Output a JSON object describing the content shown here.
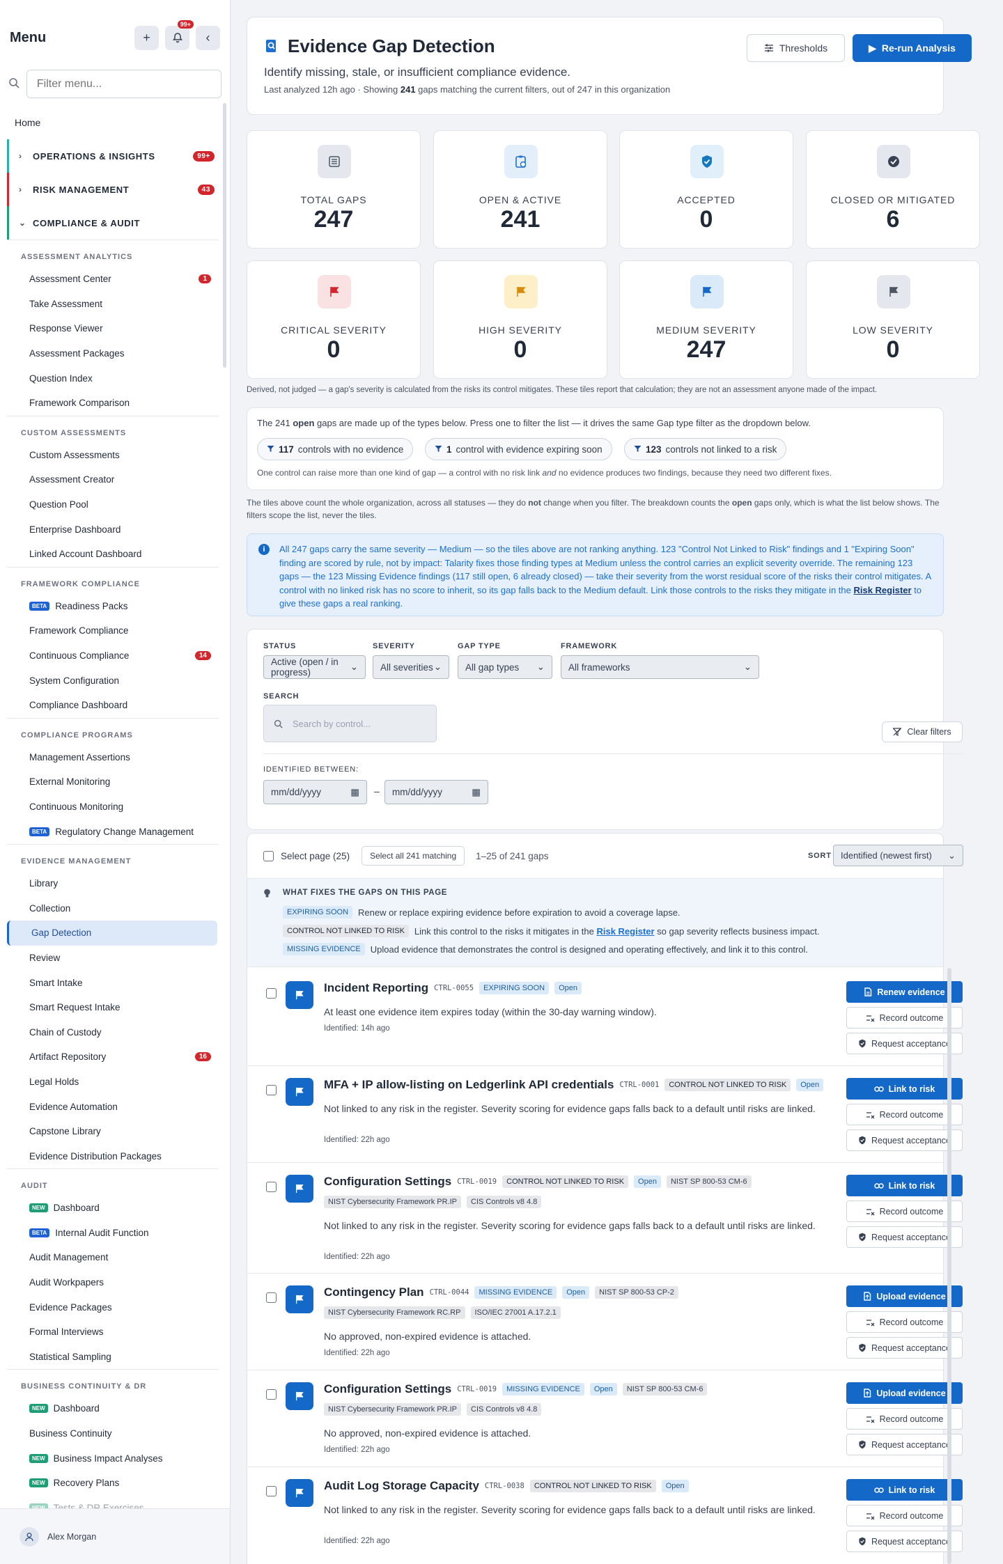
{
  "sidebar": {
    "title": "Menu",
    "notif_badge": "99+",
    "filter_placeholder": "Filter menu...",
    "home": "Home",
    "groups": {
      "ops": {
        "label": "OPERATIONS & INSIGHTS",
        "count": "99+"
      },
      "risk": {
        "label": "RISK MANAGEMENT",
        "count": "43"
      },
      "comp": {
        "label": "COMPLIANCE & AUDIT"
      }
    },
    "sections": {
      "assess": {
        "label": "ASSESSMENT ANALYTICS",
        "items": [
          "Assessment Center",
          "Take Assessment",
          "Response Viewer",
          "Assessment Packages",
          "Question Index",
          "Framework Comparison"
        ],
        "assess_center_count": "1"
      },
      "custom": {
        "label": "CUSTOM ASSESSMENTS",
        "items": [
          "Custom Assessments",
          "Assessment Creator",
          "Question Pool",
          "Enterprise Dashboard",
          "Linked Account Dashboard"
        ]
      },
      "framework": {
        "label": "FRAMEWORK COMPLIANCE",
        "items": [
          "Readiness Packs",
          "Framework Compliance",
          "Continuous Compliance",
          "System Configuration",
          "Compliance Dashboard"
        ],
        "cc_count": "14"
      },
      "programs": {
        "label": "COMPLIANCE PROGRAMS",
        "items": [
          "Management Assertions",
          "External Monitoring",
          "Continuous Monitoring",
          "Regulatory Change Management"
        ]
      },
      "evidence": {
        "label": "EVIDENCE MANAGEMENT",
        "items": [
          "Library",
          "Collection",
          "Gap Detection",
          "Review",
          "Smart Intake",
          "Smart Request Intake",
          "Chain of Custody",
          "Artifact Repository",
          "Legal Holds",
          "Evidence Automation",
          "Capstone Library",
          "Evidence Distribution Packages"
        ],
        "artifact_count": "16"
      },
      "audit": {
        "label": "AUDIT",
        "items": [
          "Dashboard",
          "Internal Audit Function",
          "Audit Management",
          "Audit Workpapers",
          "Evidence Packages",
          "Formal Interviews",
          "Statistical Sampling"
        ]
      },
      "bcdr": {
        "label": "BUSINESS CONTINUITY & DR",
        "items": [
          "Dashboard",
          "Business Continuity",
          "Business Impact Analyses",
          "Recovery Plans",
          "Tests & DR Exercises"
        ]
      }
    },
    "tags": {
      "beta": "BETA",
      "new": "NEW"
    },
    "user": "Alex Morgan"
  },
  "header": {
    "title": "Evidence Gap Detection",
    "subtitle": "Identify missing, stale, or insufficient compliance evidence.",
    "meta_prefix": "Last analyzed 12h ago · Showing ",
    "meta_count": "241",
    "meta_suffix": " gaps matching the current filters, out of 247 in this organization",
    "thresholds": "Thresholds",
    "rerun": "Re-run Analysis"
  },
  "tiles": [
    {
      "label": "TOTAL GAPS",
      "value": "247"
    },
    {
      "label": "OPEN & ACTIVE",
      "value": "241"
    },
    {
      "label": "ACCEPTED",
      "value": "0"
    },
    {
      "label": "CLOSED OR MITIGATED",
      "value": "6"
    },
    {
      "label": "CRITICAL SEVERITY",
      "value": "0"
    },
    {
      "label": "HIGH SEVERITY",
      "value": "0"
    },
    {
      "label": "MEDIUM SEVERITY",
      "value": "247"
    },
    {
      "label": "LOW SEVERITY",
      "value": "0"
    }
  ],
  "derived_note": "Derived, not judged — a gap's severity is calculated from the risks its control mitigates. These tiles report that calculation; they are not an assessment anyone made of the impact.",
  "breakdown": {
    "lead_a": "The 241 ",
    "lead_b": "open",
    "lead_c": " gaps are made up of the types below. Press one to filter the list — it drives the same Gap type filter as the dropdown below.",
    "pills": [
      {
        "count": "117",
        "text": "controls with no evidence"
      },
      {
        "count": "1",
        "text": "control with evidence expiring soon"
      },
      {
        "count": "123",
        "text": "controls not linked to a risk"
      }
    ],
    "note_a": "One control can raise more than one kind of gap — a control with no risk link ",
    "note_b": "and",
    "note_c": " no evidence produces two findings, because they need two different fixes."
  },
  "tiles_note": {
    "a": "The tiles above count the whole organization, across all statuses — they do ",
    "b": "not",
    "c": " change when you filter. The breakdown counts the ",
    "d": "open",
    "e": " gaps only, which is what the list below shows. The filters scope the list, never the tiles."
  },
  "info": {
    "text": "All 247 gaps carry the same severity — Medium — so the tiles above are not ranking anything. 123 \"Control Not Linked to Risk\" findings and 1 \"Expiring Soon\" finding are scored by rule, not by impact: Talarity fixes those finding types at Medium unless the control carries an explicit severity override. The remaining 123 gaps — the 123 Missing Evidence findings (117 still open, 6 already closed) — take their severity from the worst residual score of the risks their control mitigates. A control with no linked risk has no score to inherit, so its gap falls back to the Medium default. Link those controls to the risks they mitigate in the ",
    "link": "Risk Register",
    "tail": " to give these gaps a real ranking."
  },
  "filters": {
    "status_label": "STATUS",
    "status_value": "Active (open / in progress)",
    "severity_label": "SEVERITY",
    "severity_value": "All severities",
    "gaptype_label": "GAP TYPE",
    "gaptype_value": "All gap types",
    "framework_label": "FRAMEWORK",
    "framework_value": "All frameworks",
    "search_label": "SEARCH",
    "search_placeholder": "Search by control...",
    "clear": "Clear filters",
    "between_label": "IDENTIFIED BETWEEN:",
    "date_placeholder": "mm/dd/yyyy",
    "dash": "–"
  },
  "list": {
    "select_page": "Select page (25)",
    "select_all": "Select all 241 matching",
    "range": "1–25 of 241 gaps",
    "sort_label": "SORT",
    "sort_value": "Identified (newest first)",
    "tip_title": "WHAT FIXES THE GAPS ON THIS PAGE",
    "tip_expiring_tag": "EXPIRING SOON",
    "tip_expiring": "Renew or replace expiring evidence before expiration to avoid a coverage lapse.",
    "tip_cnl_tag": "CONTROL NOT LINKED TO RISK",
    "tip_cnl_a": "Link this control to the risks it mitigates in the ",
    "tip_cnl_link": "Risk Register",
    "tip_cnl_b": " so gap severity reflects business impact.",
    "tip_missing_tag": "MISSING EVIDENCE",
    "tip_missing": "Upload evidence that demonstrates the control is designed and operating effectively, and link it to this control."
  },
  "rows": [
    {
      "name": "Incident Reporting",
      "id": "CTRL-0055",
      "type": "EXPIRING SOON",
      "status": "Open",
      "fw_inline": "",
      "fws": [],
      "desc": "At least one evidence item expires today (within the 30-day warning window).",
      "identified": "Identified: 14h ago",
      "primary": "Renew evidence",
      "record": "Record outcome",
      "accept": "Request acceptance"
    },
    {
      "name": "MFA + IP allow-listing on Ledgerlink API credentials",
      "id": "CTRL-0001",
      "type": "CONTROL NOT LINKED TO RISK",
      "status": "Open",
      "fw_inline": "",
      "fws": [],
      "desc": "Not linked to any risk in the register. Severity scoring for evidence gaps falls back to a default until risks are linked.",
      "identified": "Identified: 22h ago",
      "primary": "Link to risk",
      "record": "Record outcome",
      "accept": "Request acceptance"
    },
    {
      "name": "Configuration Settings",
      "id": "CTRL-0019",
      "type": "CONTROL NOT LINKED TO RISK",
      "status": "Open",
      "fw_inline": "NIST SP 800-53 CM-6",
      "fws": [
        "NIST Cybersecurity Framework PR.IP",
        "CIS Controls v8 4.8"
      ],
      "desc": "Not linked to any risk in the register. Severity scoring for evidence gaps falls back to a default until risks are linked.",
      "identified": "Identified: 22h ago",
      "primary": "Link to risk",
      "record": "Record outcome",
      "accept": "Request acceptance"
    },
    {
      "name": "Contingency Plan",
      "id": "CTRL-0044",
      "type": "MISSING EVIDENCE",
      "status": "Open",
      "fw_inline": "NIST SP 800-53 CP-2",
      "fws": [
        "NIST Cybersecurity Framework RC.RP",
        "ISO/IEC 27001 A.17.2.1"
      ],
      "desc": "No approved, non-expired evidence is attached.",
      "identified": "Identified: 22h ago",
      "primary": "Upload evidence",
      "record": "Record outcome",
      "accept": "Request acceptance"
    },
    {
      "name": "Configuration Settings",
      "id": "CTRL-0019",
      "type": "MISSING EVIDENCE",
      "status": "Open",
      "fw_inline": "NIST SP 800-53 CM-6",
      "fws": [
        "NIST Cybersecurity Framework PR.IP",
        "CIS Controls v8 4.8"
      ],
      "desc": "No approved, non-expired evidence is attached.",
      "identified": "Identified: 22h ago",
      "primary": "Upload evidence",
      "record": "Record outcome",
      "accept": "Request acceptance"
    },
    {
      "name": "Audit Log Storage Capacity",
      "id": "CTRL-0038",
      "type": "CONTROL NOT LINKED TO RISK",
      "status": "Open",
      "fw_inline": "",
      "fws": [],
      "desc": "Not linked to any risk in the register. Severity scoring for evidence gaps falls back to a default until risks are linked.",
      "identified": "Identified: 22h ago",
      "primary": "Link to risk",
      "record": "Record outcome",
      "accept": "Request acceptance"
    }
  ],
  "colors": {
    "accent": "#1469c8",
    "danger": "#d3252c",
    "teal": "#2ab0a9",
    "green": "#1e9e74"
  }
}
